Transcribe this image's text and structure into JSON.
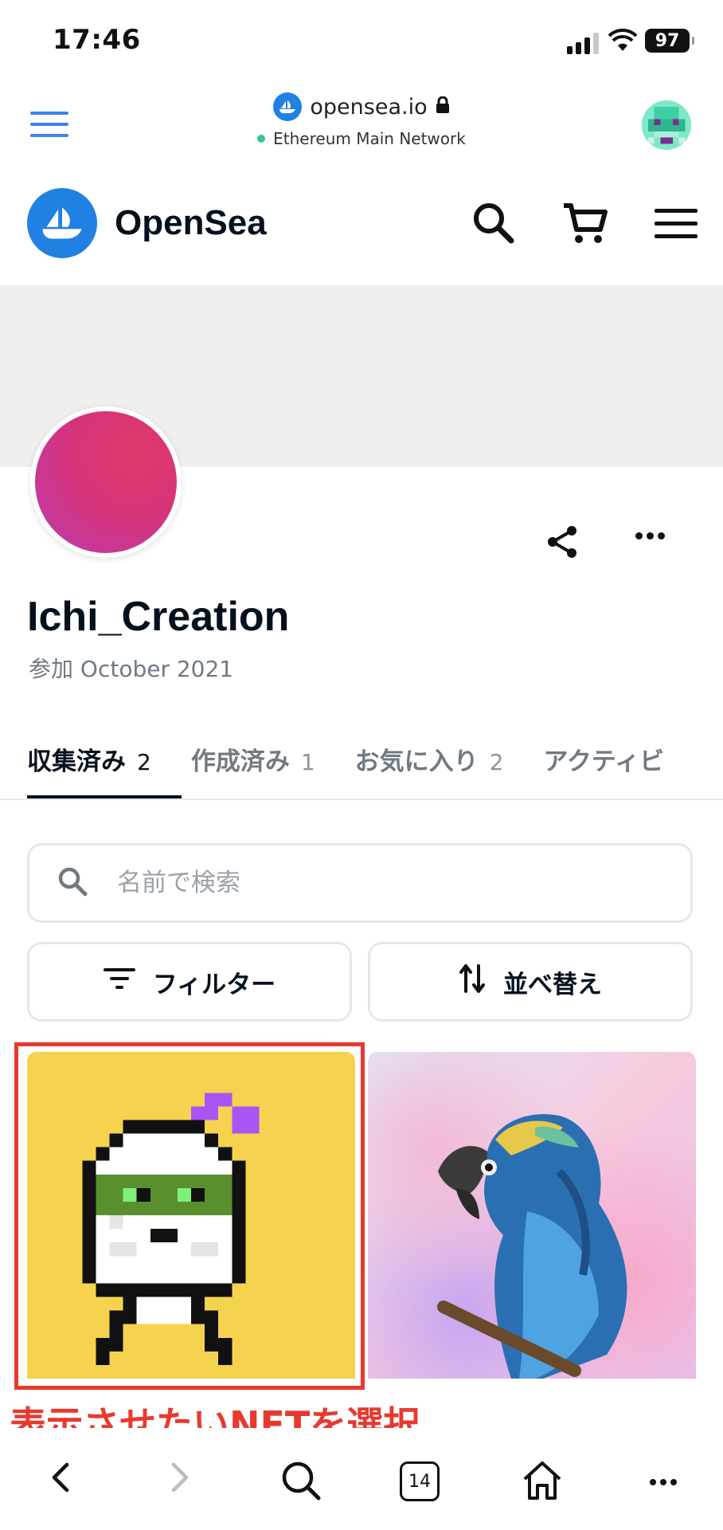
{
  "status_bar": {
    "time": "17:46",
    "battery": "97"
  },
  "browser": {
    "domain": "opensea.io",
    "network": "Ethereum Main Network",
    "tabs_count": "14"
  },
  "header": {
    "brand": "OpenSea"
  },
  "profile": {
    "username": "Ichi_Creation",
    "joined": "参加 October 2021"
  },
  "tabs": [
    {
      "label": "収集済み",
      "count": "2",
      "active": true
    },
    {
      "label": "作成済み",
      "count": "1",
      "active": false
    },
    {
      "label": "お気に入り",
      "count": "2",
      "active": false
    },
    {
      "label": "アクティビ",
      "count": "",
      "active": false
    }
  ],
  "search": {
    "placeholder": "名前で検索"
  },
  "buttons": {
    "filter": "フィルター",
    "sort": "並べ替え"
  },
  "nfts": [
    {
      "image": "pixel-art-character",
      "selected": true
    },
    {
      "image": "blue-parrot-painting",
      "selected": false
    }
  ],
  "annotation": "表示させたいNFTを選択",
  "colors": {
    "accent_blue": "#2081e2",
    "annotation_red": "#e8392f",
    "nft1_background": "#f5d34e",
    "avatar_pink": "#d6337a"
  }
}
